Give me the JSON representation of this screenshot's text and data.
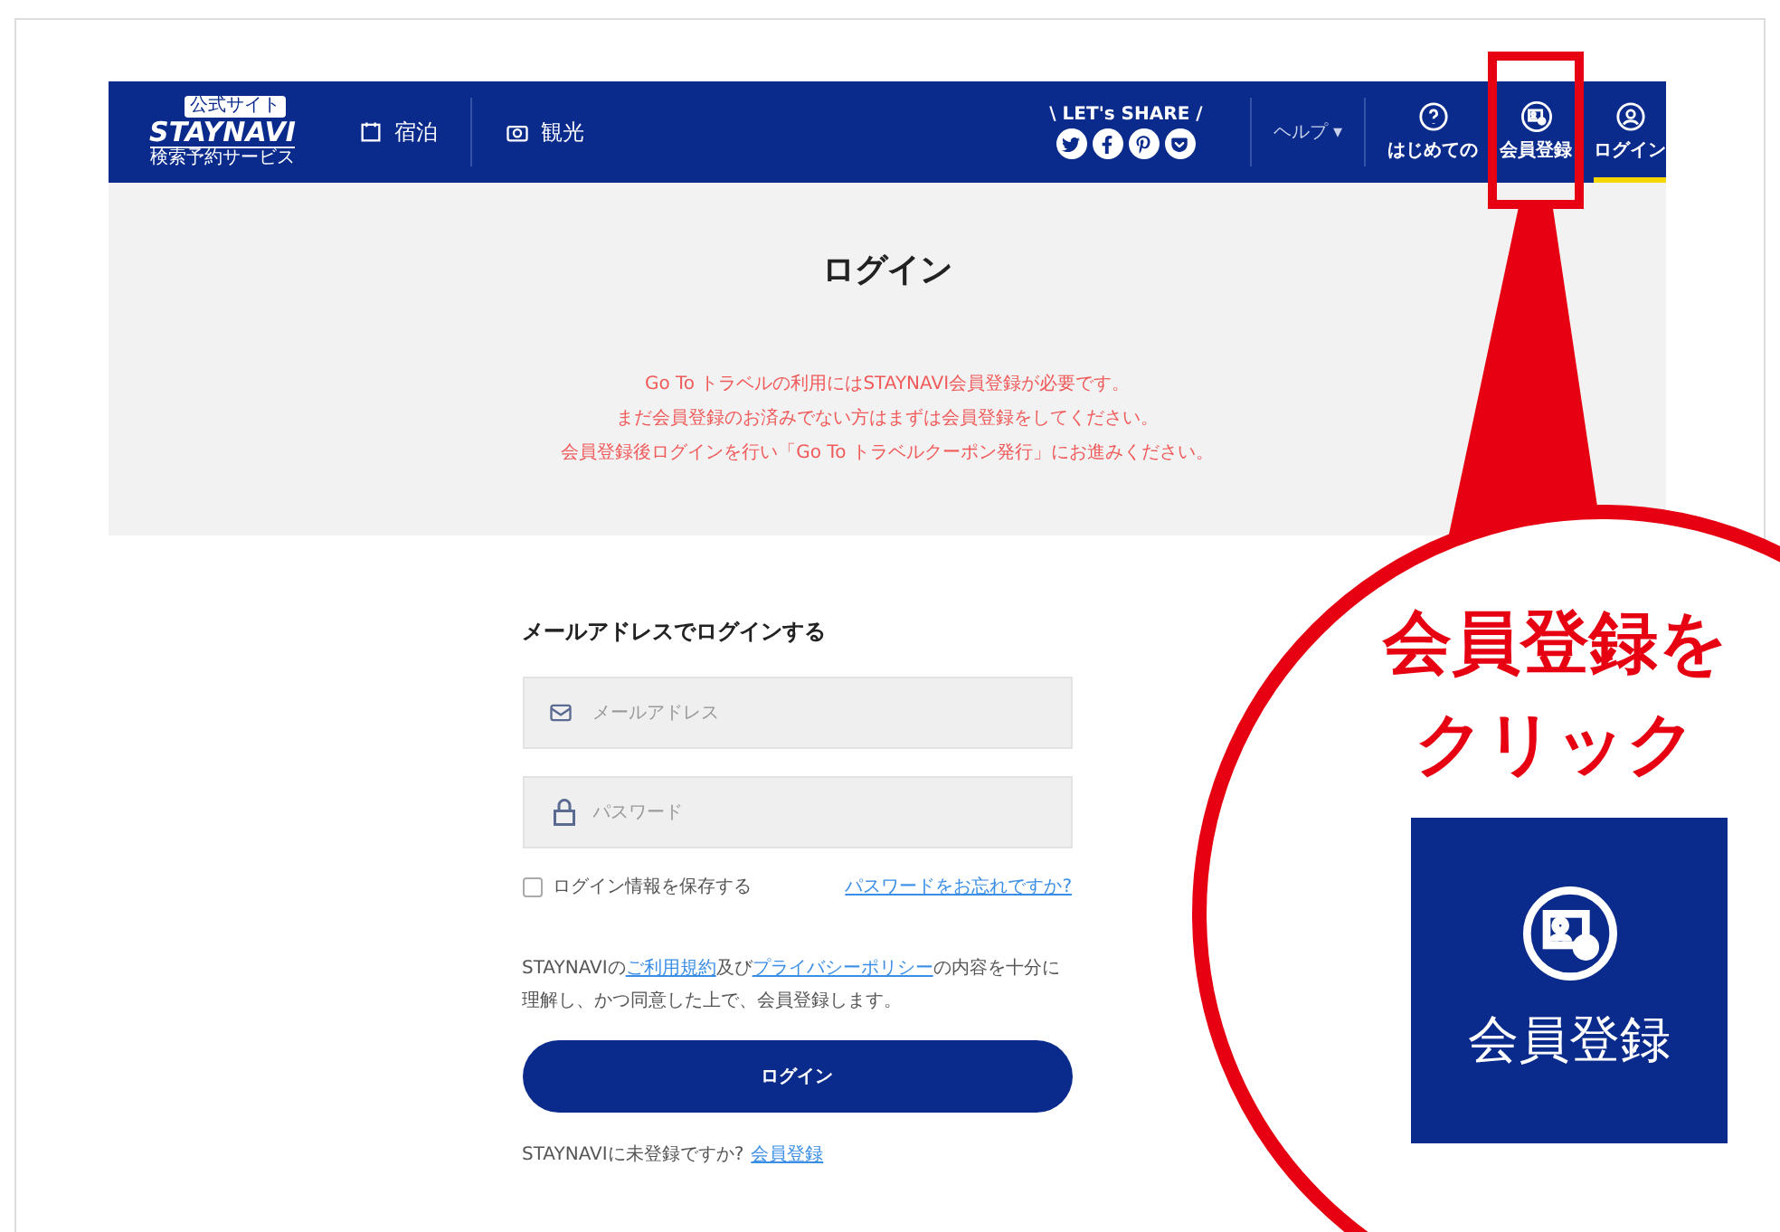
{
  "header": {
    "logo": {
      "badge": "公式サイト",
      "name": "STAYNAVI",
      "tagline": "検索予約サービス"
    },
    "nav": [
      {
        "kind": "stay",
        "label": "宿泊"
      },
      {
        "kind": "sightseeing",
        "label": "観光"
      }
    ],
    "share": {
      "label": "\\ LET's SHARE /",
      "networks": [
        {
          "kind": "twitter"
        },
        {
          "kind": "facebook"
        },
        {
          "kind": "pinterest"
        },
        {
          "kind": "pocket"
        }
      ]
    },
    "help": {
      "label": "ヘルプ ▾"
    },
    "user_nav": [
      {
        "kind": "guide",
        "label": "はじめての",
        "selected": false
      },
      {
        "kind": "register",
        "label": "会員登録",
        "selected": false
      },
      {
        "kind": "login",
        "label": "ログイン",
        "selected": true
      }
    ]
  },
  "hero": {
    "title": "ログイン",
    "notice": [
      "Go To トラベルの利用にはSTAYNAVI会員登録が必要です。",
      "まだ会員登録のお済みでない方はまずは会員登録をしてください。",
      "会員登録後ログインを行い「Go To トラベルクーポン発行」にお進みください。"
    ]
  },
  "form": {
    "heading": "メールアドレスでログインする",
    "fields": [
      {
        "kind": "email",
        "placeholder": "メールアドレス"
      },
      {
        "kind": "password",
        "placeholder": "パスワード"
      }
    ],
    "remember": {
      "label": "ログイン情報を保存する",
      "checked": false
    },
    "forgot": "パスワードをお忘れですか?",
    "agreement": {
      "prefix": "STAYNAVIの",
      "terms": "ご利用規約",
      "middle": "及び",
      "privacy": "プライバシーポリシー",
      "suffix": "の内容を十分に理解し、かつ同意した上で、会員登録します。"
    },
    "submit": "ログイン",
    "signup": {
      "text": "STAYNAVIに未登録ですか?",
      "link": "会員登録"
    }
  },
  "callout": {
    "lines": [
      "会員登録を",
      "クリック"
    ],
    "button_label": "会員登録"
  }
}
